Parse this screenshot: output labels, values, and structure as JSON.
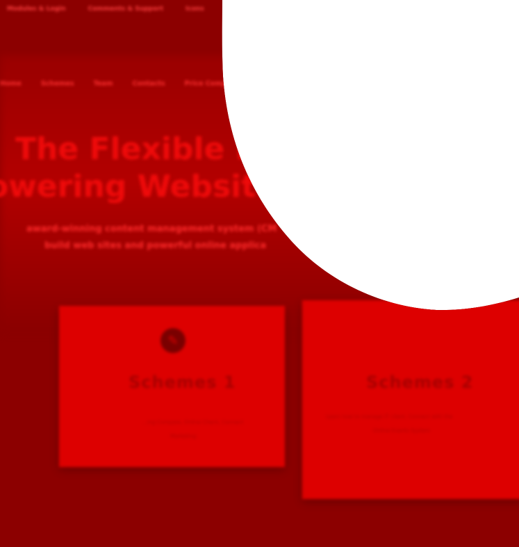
{
  "top_nav": {
    "items": [
      "Modules & Login",
      "Comments & Support",
      "Icons"
    ]
  },
  "main_nav": {
    "items": [
      "Home",
      "Schemes",
      "Team",
      "Contacts",
      "Price Compare"
    ]
  },
  "hero": {
    "title_line1": "The Flexible Pla",
    "title_line2": "owering Websit",
    "lead_line1": "award-winning content management system (CM",
    "lead_line2": "build web sites and powerful online applica"
  },
  "cards": [
    {
      "title": "Schemes 1",
      "icon": "pencil-icon",
      "text_line1": "...ing Compare, Online Check, Connect",
      "text_line2": "Marketing"
    },
    {
      "title": "Schemes 2",
      "text_line1": "Learn how to manage IT client, Connect with the",
      "text_line2": "Online Events System"
    }
  ],
  "colors": {
    "ring_dark": "#8c0000",
    "card": "#dd0000",
    "background": "#ffffff"
  }
}
